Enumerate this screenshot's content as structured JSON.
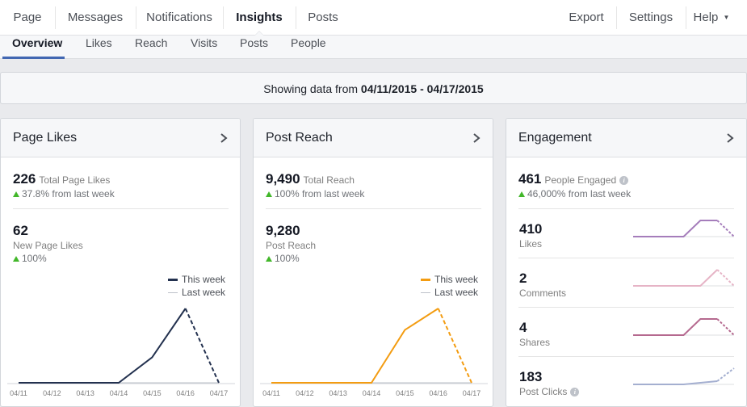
{
  "topnav": {
    "left": [
      "Page",
      "Messages",
      "Notifications",
      "Insights",
      "Posts"
    ],
    "right": [
      "Export",
      "Settings",
      "Help"
    ],
    "active": "Insights"
  },
  "subnav": {
    "tabs": [
      "Overview",
      "Likes",
      "Reach",
      "Visits",
      "Posts",
      "People"
    ],
    "active": "Overview"
  },
  "banner": {
    "prefix": "Showing data from ",
    "range": "04/11/2015 - 04/17/2015"
  },
  "cards": {
    "page_likes": {
      "title": "Page Likes",
      "total": "226",
      "total_label": "Total Page Likes",
      "total_change": "37.8% from last week",
      "new": "62",
      "new_label": "New Page Likes",
      "new_change": "100%",
      "legend_this": "This week",
      "legend_last": "Last week",
      "color": "#23314f"
    },
    "post_reach": {
      "title": "Post Reach",
      "total": "9,490",
      "total_label": "Total Reach",
      "total_change": "100% from last week",
      "new": "9,280",
      "new_label": "Post Reach",
      "new_change": "100%",
      "legend_this": "This week",
      "legend_last": "Last week",
      "color": "#f39c11"
    },
    "engagement": {
      "title": "Engagement",
      "total": "461",
      "total_label": "People Engaged",
      "total_change": "46,000% from last week",
      "rows": [
        {
          "value": "410",
          "label": "Likes",
          "color": "#a57dbb"
        },
        {
          "value": "2",
          "label": "Comments",
          "color": "#e6b4c6"
        },
        {
          "value": "4",
          "label": "Shares",
          "color": "#b5698f"
        },
        {
          "value": "183",
          "label": "Post Clicks",
          "color": "#a4afd0"
        }
      ]
    }
  },
  "chart_data": [
    {
      "type": "line",
      "title": "Page Likes",
      "x": [
        "04/11",
        "04/12",
        "04/13",
        "04/14",
        "04/15",
        "04/16",
        "04/17"
      ],
      "series": [
        {
          "name": "This week",
          "values": [
            0,
            0,
            0,
            0,
            14,
            41,
            0
          ]
        },
        {
          "name": "Last week",
          "values": [
            0,
            0,
            0,
            0,
            0,
            0,
            0
          ]
        }
      ],
      "last_segment_dashed": true
    },
    {
      "type": "line",
      "title": "Post Reach",
      "x": [
        "04/11",
        "04/12",
        "04/13",
        "04/14",
        "04/15",
        "04/16",
        "04/17"
      ],
      "series": [
        {
          "name": "This week",
          "values": [
            0,
            0,
            0,
            0,
            3200,
            4500,
            0
          ]
        },
        {
          "name": "Last week",
          "values": [
            0,
            0,
            0,
            0,
            0,
            0,
            0
          ]
        }
      ],
      "last_segment_dashed": true
    },
    {
      "type": "line",
      "title": "Likes",
      "values": [
        0,
        0,
        0,
        0,
        1,
        1,
        0
      ]
    },
    {
      "type": "line",
      "title": "Comments",
      "values": [
        0,
        0,
        0,
        0,
        0,
        1,
        0
      ]
    },
    {
      "type": "line",
      "title": "Shares",
      "values": [
        0,
        0,
        0,
        0,
        1,
        1,
        0
      ]
    },
    {
      "type": "line",
      "title": "Post Clicks",
      "values": [
        0,
        0,
        0,
        0,
        0.1,
        0.2,
        1
      ]
    }
  ]
}
